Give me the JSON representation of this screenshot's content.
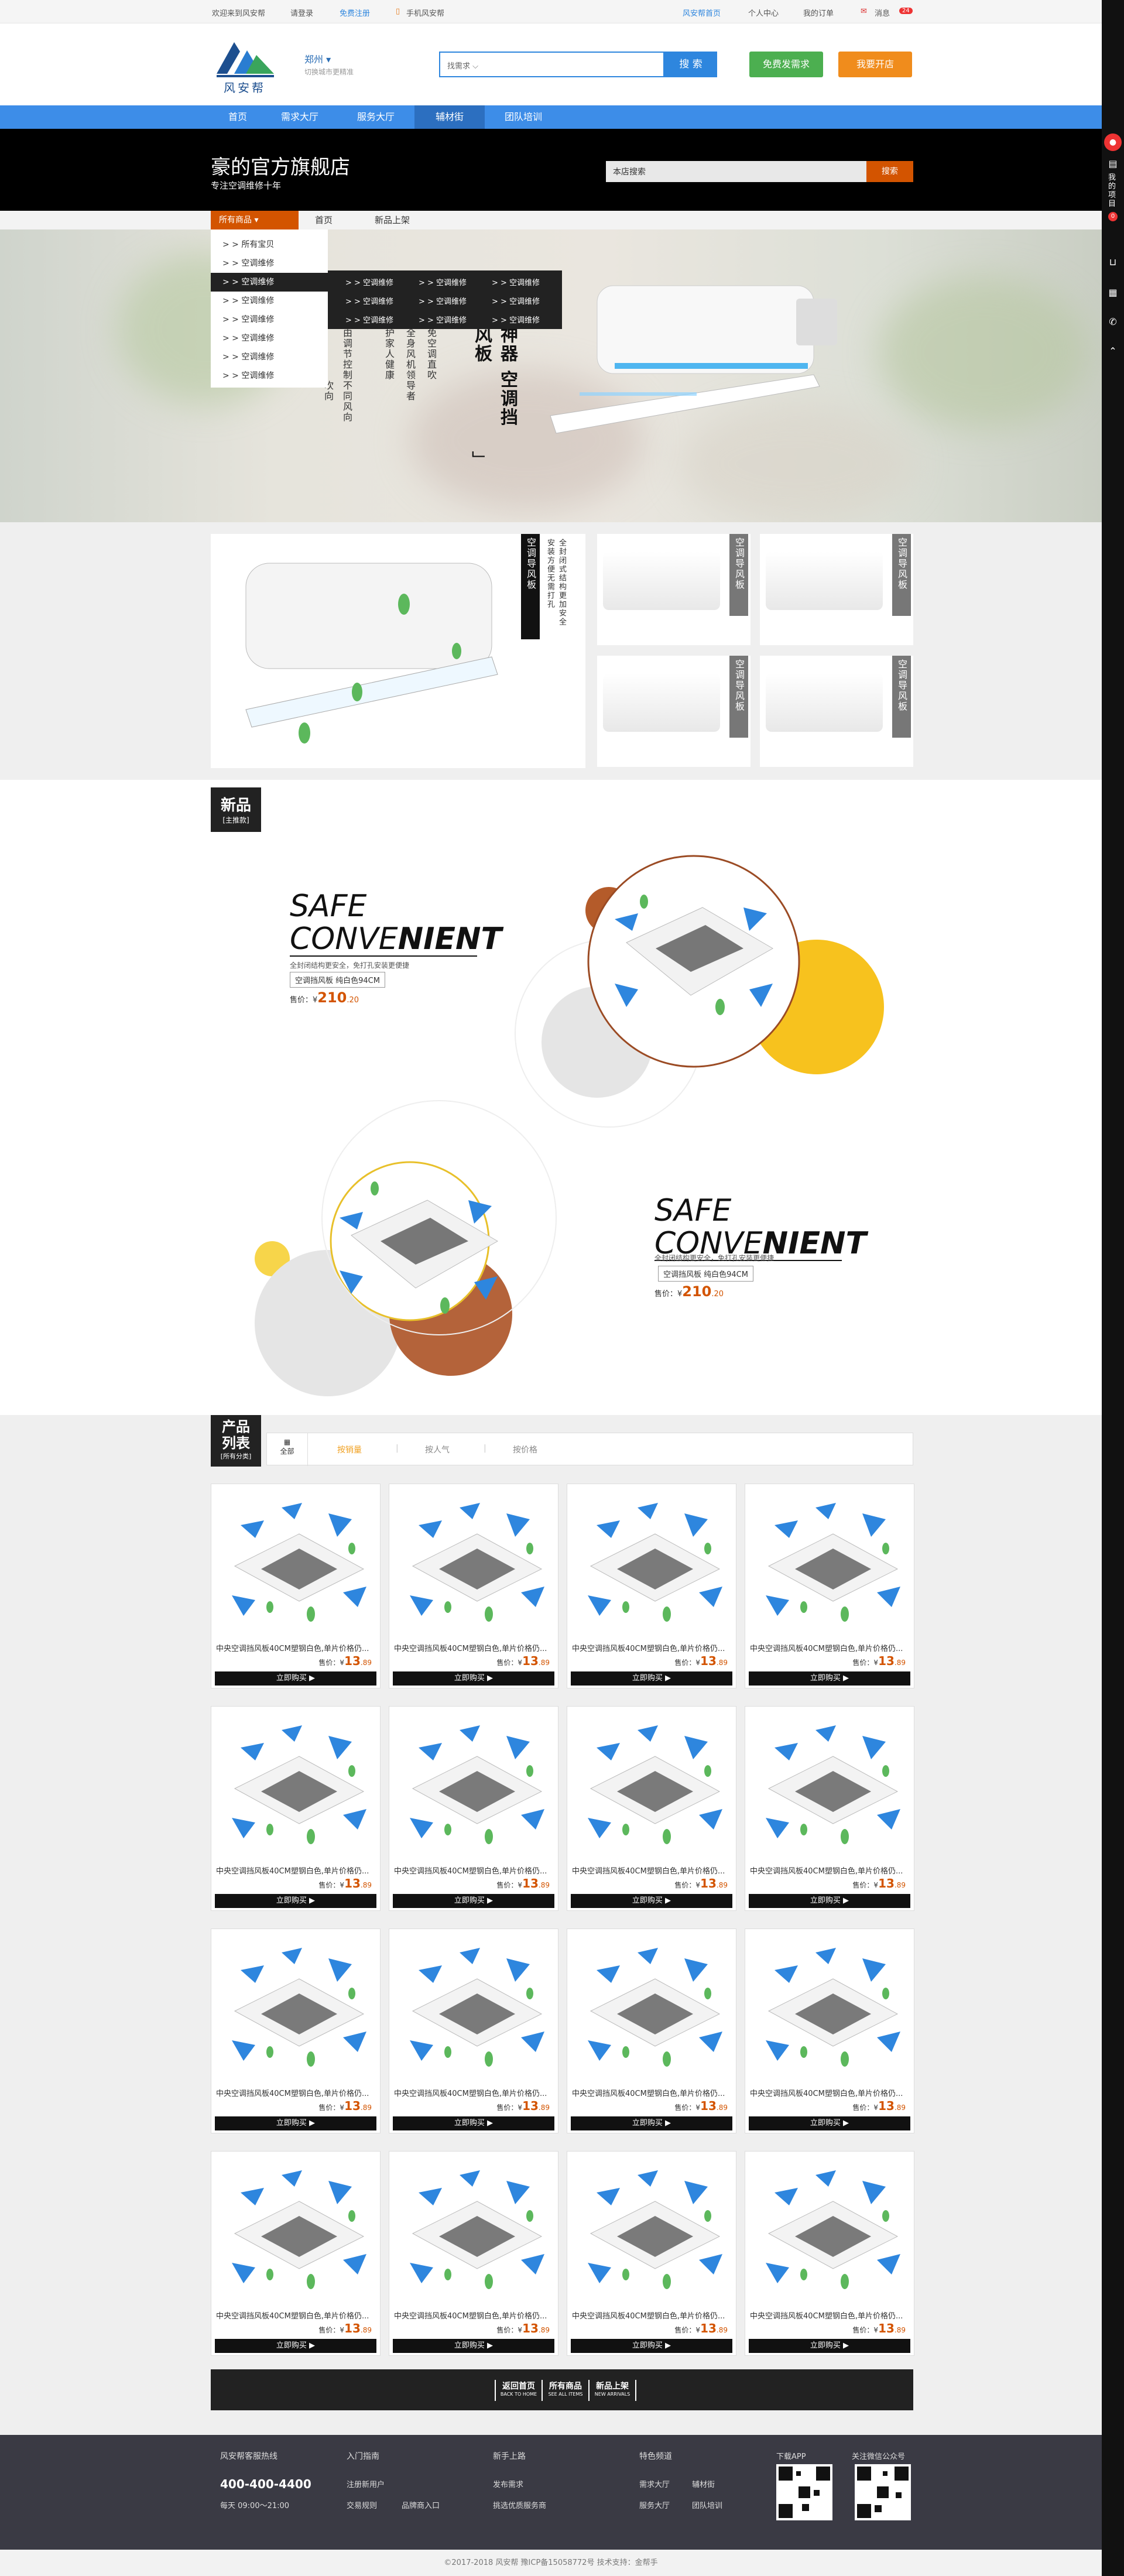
{
  "topbar": {
    "welcome": "欢迎来到风安帮",
    "login": "请登录",
    "register": "免费注册",
    "mobile": "手机风安帮",
    "home": "风安帮首页",
    "personal": "个人中心",
    "orders": "我的订单",
    "messages": "消息",
    "msg_count": "24"
  },
  "header": {
    "logo_text": "风安帮",
    "city": "郑州",
    "city_sub": "切换城市更精准",
    "search_select": "找需求",
    "search_button": "搜 索",
    "post_button": "免费发需求",
    "open_button": "我要开店"
  },
  "nav": [
    "首页",
    "需求大厅",
    "服务大厅",
    "辅材街",
    "团队培训"
  ],
  "shop": {
    "name": "豪的官方旗舰店",
    "subtitle": "专注空调维修十年",
    "search_placeholder": "本店搜索",
    "search_button": "搜索"
  },
  "catbar": {
    "all": "所有商品",
    "items": [
      "首页",
      "新品上架"
    ]
  },
  "menu": [
    "> > 所有宝贝",
    "> > 空调维修",
    "> > 空调维修",
    "> > 空调维修",
    "> > 空调维修",
    "> > 空调维修",
    "> > 空调维修",
    "> > 空调维修"
  ],
  "submenu": [
    "> > 空调维修",
    "> > 空调维修",
    "> > 空调维修",
    "> > 空调维修",
    "> > 空调维修",
    "> > 空调维修",
    "> > 空调维修",
    "> > 空调维修",
    "> > 空调维修"
  ],
  "banner": {
    "v1": "由调节控制不同风向",
    "v2": "吹向",
    "v3": "护家人健康",
    "v4": "全身风机领导者",
    "v5": "免空调直吹",
    "v6": "神器 空调挡风板",
    "v7": "」"
  },
  "feature": {
    "label": "空调导风板",
    "desc1": "全封闭式结构更加安全",
    "desc2": "安装方便无需打孔",
    "small_labels": [
      "空调导风板",
      "空调导风板",
      "空调导风板",
      "空调导风板"
    ]
  },
  "newtag": {
    "title": "新品",
    "sub": "[主推款]"
  },
  "promo1": {
    "line1": "SAFE",
    "line2a": "CONVE",
    "line2b": "NIENT",
    "desc": "全封闭结构更安全，免打孔安装更便捷",
    "box": "空调挡风板 纯白色94CM",
    "price_label": "售价：¥",
    "price_int": "210",
    "price_dec": ".20"
  },
  "promo2": {
    "line1": "SAFE",
    "line2a": "CONVE",
    "line2b": "NIENT",
    "desc": "全封闭结构更安全，免打孔安装更便捷",
    "box": "空调挡风板 纯白色94CM",
    "price_label": "售价：¥",
    "price_int": "210",
    "price_dec": ".20"
  },
  "listtag": {
    "title": "产品列表",
    "sub": "[所有分类]",
    "all": "全部"
  },
  "sort": [
    "按销量",
    "按人气",
    "按价格"
  ],
  "product": {
    "title": "中央空调挡风板40CM塑钢白色,单片价格仍...",
    "price_label": "售价：¥",
    "price_int": "13",
    "price_dec": ".89",
    "buy": "立即购买 ▶"
  },
  "bottomnav": [
    {
      "cn": "返回首页",
      "en": "BACK TO HOME"
    },
    {
      "cn": "所有商品",
      "en": "SEE ALL ITEMS"
    },
    {
      "cn": "新品上架",
      "en": "NEW ARRIVALS"
    }
  ],
  "footer": {
    "hotline_title": "风安帮客服热线",
    "hotline": "400-400-4400",
    "hours": "每天 09:00～21:00",
    "guide_title": "入门指南",
    "guide": [
      "注册新用户",
      "交易规则",
      "品牌商入口"
    ],
    "newbie_title": "新手上路",
    "newbie": [
      "发布需求",
      "挑选优质服务商"
    ],
    "special_title": "特色频道",
    "special": [
      "需求大厅",
      "服务大厅",
      "辅材街",
      "团队培训"
    ],
    "app_title": "下载APP",
    "wechat_title": "关注微信公众号"
  },
  "copyright": "©2017-2018  风安帮 豫ICP备15058772号  技术支持：金帮手",
  "side": {
    "label": "我的项目",
    "count": "0"
  }
}
